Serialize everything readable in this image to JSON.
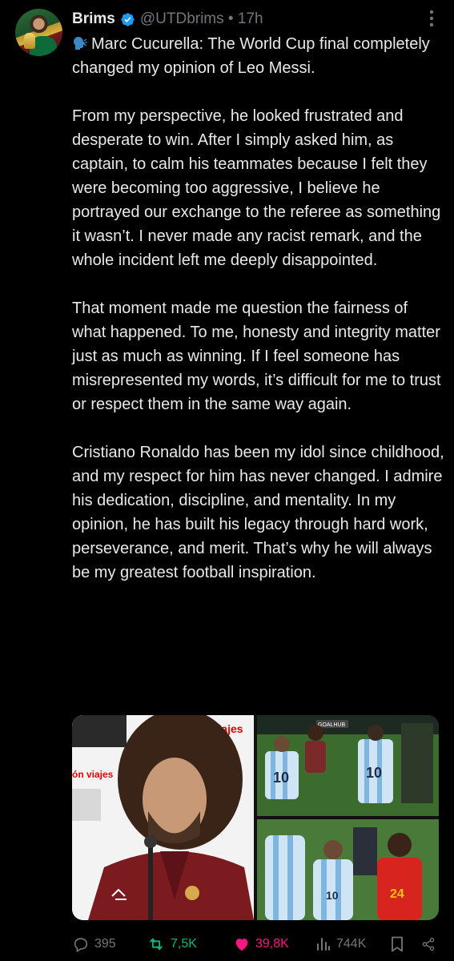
{
  "author": {
    "display_name": "Brims",
    "handle_time": "@UTDbrims • 17h"
  },
  "tweet": {
    "paragraphs": [
      "Marc Cucurella: The World Cup final completely changed my opinion of Leo Messi.",
      "From my perspective, he looked frustrated and desperate to win. After I simply asked him, as captain, to calm his teammates because I felt they were becoming too aggressive, I believe he portrayed our exchange to the referee as something it wasn’t. I never made any racist remark, and the whole incident left me deeply disappointed.",
      "That moment made me question the fairness of what happened. To me, honesty and integrity matter just as much as winning. If I feel someone has misrepresented my words, it’s difficult for me to trust or respect them in the same way again.",
      "Cristiano Ronaldo has been my idol since childhood, and my respect for him has never changed. I admire his dedication, discipline, and mentality. In my opinion, he has built his legacy through hard work, perseverance, and merit. That’s why he will always be my greatest football inspiration."
    ]
  },
  "media": {
    "main_banner_text": "Vodafone viajes",
    "main_side_text": "ón viajes",
    "watermark": "GOALHUB",
    "shirt_number_a": "10",
    "shirt_number_b": "10",
    "shirt_number_c": "24",
    "shirt_number_d": "10"
  },
  "actions": {
    "replies": "395",
    "reposts": "7,5K",
    "likes": "39,8K",
    "views": "744K"
  },
  "colors": {
    "background": "#000000",
    "text": "#e7e9ea",
    "muted": "#71767b",
    "verified": "#1d9bf0",
    "repost_active": "#00ba7c",
    "like_active": "#f91880"
  }
}
